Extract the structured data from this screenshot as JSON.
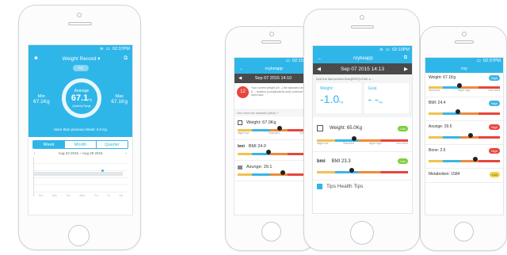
{
  "phone1": {
    "status_time": "02:37PM",
    "nav_title": "Weight Record ▾",
    "unit_pill": "Kg",
    "min_label": "Min",
    "min_value": "67.1Kg",
    "max_label": "Max",
    "max_value": "67.1Kg",
    "avg_label": "Average",
    "avg_value": "67.1",
    "avg_unit": "Kg",
    "avg_sub": "Quarterly Range",
    "compare_text": "More than previous Week: 0.0 Kg",
    "tabs": [
      "Week",
      "Month",
      "Quarter"
    ],
    "date_range": "Aug 23 2015 ~ Aug 29 2015",
    "day_labels": [
      "Sun",
      "Mon",
      "Tue",
      "Wed",
      "Thu",
      "Fri",
      "Sat"
    ]
  },
  "phone2": {
    "status_time": "02:15PM",
    "nav_title": "roykeapp",
    "date": "Sep 07  2015  14:10",
    "alert_number": "12",
    "alert_text": "Your current weight (ch...) the standard range. It ... function (complications and) continue to work hard.",
    "hint_text": "See more the standard (item) ?",
    "items": [
      {
        "label": "Weight:  67.0Kg"
      },
      {
        "label": "BMI  24.0"
      },
      {
        "label": "Axunge:  29.1"
      }
    ],
    "scale_labels": [
      "slight low",
      "Standard",
      "Axunge"
    ]
  },
  "phone3": {
    "status_time": "02:10PM",
    "nav_title": "roykeapp",
    "date": "Sep 07  2015  14:13",
    "test_text": "And the last section than(0907)of the s...",
    "weight_label": "Weight:",
    "weight_value": "-1.0",
    "weight_unit": "Kg",
    "goal_label": "Goal.",
    "goal_value": "- -",
    "goal_unit": "Kg",
    "items": [
      {
        "label": "Weight:  65.0Kg",
        "badge": "Low"
      },
      {
        "label": "BMI   23.3",
        "badge": "Low"
      }
    ],
    "scale_labels": [
      "slight low",
      "Standard",
      "slight high",
      "over-alert"
    ],
    "tips_label": "Tips Health Tips"
  },
  "phone4": {
    "status_time": "02:37PM",
    "nav_title": "roy",
    "items": [
      {
        "label": "Weight:  67.1Kg",
        "badge": "High",
        "color": "#3bb5e6"
      },
      {
        "label": "BMI:  24.4",
        "badge": "High",
        "color": "#3bb5e6"
      },
      {
        "label": "Axunge:  29.5",
        "badge": "High",
        "color": "#e8453c"
      },
      {
        "label": "Bone:  2.5",
        "badge": "High",
        "color": "#e8453c"
      },
      {
        "label": "Metabolism:  1584",
        "badge": "Low",
        "color": "#f2d13c"
      }
    ],
    "scale_labels": [
      "Standard",
      "slight high",
      "over-alert"
    ]
  },
  "colors": {
    "accent": "#2fb6e9",
    "dark_bar": "#4a4a4a",
    "alert": "#e8453c"
  }
}
